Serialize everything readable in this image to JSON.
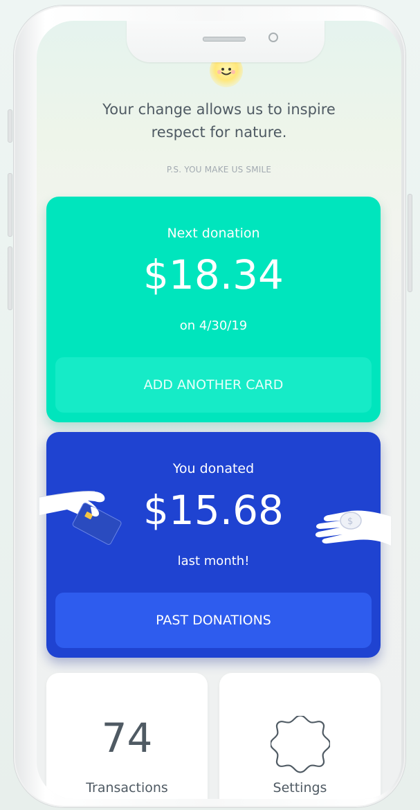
{
  "header": {
    "headline_line1": "Your change allows us to inspire",
    "headline_line2": "respect for nature.",
    "ps": "P.S. YOU MAKE US SMILE"
  },
  "next_donation": {
    "label": "Next donation",
    "amount": "$18.34",
    "date": "on 4/30/19",
    "button_label": "ADD ANOTHER CARD"
  },
  "past_donation": {
    "label": "You donated",
    "amount": "$15.68",
    "period": "last month!",
    "button_label": "PAST DONATIONS"
  },
  "tiles": {
    "transactions_count": "74",
    "transactions_label": "Transactions",
    "settings_label": "Settings",
    "settings_icon": "gear-icon"
  },
  "colors": {
    "green_card": "#00e5bd",
    "blue_card": "#1f43d1",
    "blue_button": "#2e5cee",
    "text": "#4f5a63"
  }
}
